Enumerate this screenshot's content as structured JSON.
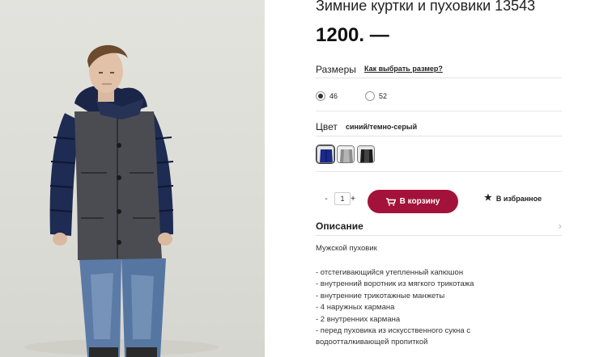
{
  "product": {
    "title": "Зимние куртки и пуховики 13543",
    "price": "1200. —",
    "photo_icon": "product-photo-man-in-winter-jacket"
  },
  "sizes": {
    "label": "Размеры",
    "guide_link": "Как выбрать размер?",
    "options": [
      {
        "label": "46",
        "selected": true
      },
      {
        "label": "52",
        "selected": false
      }
    ]
  },
  "color": {
    "label": "Цвет",
    "value": "синий/темно-серый",
    "swatches": [
      {
        "name": "blue",
        "hex": "#1a2a8a",
        "selected": true
      },
      {
        "name": "grey",
        "hex": "#b5b5b5",
        "selected": false
      },
      {
        "name": "black",
        "hex": "#1c1c1c",
        "selected": false
      }
    ]
  },
  "quantity": {
    "minus": "-",
    "value": "1",
    "plus": "+"
  },
  "actions": {
    "add_to_cart": "В корзину",
    "cart_icon": "cart-icon",
    "favorite": "В избранное",
    "favorite_icon": "star-icon",
    "accent_color": "#a3123a"
  },
  "description": {
    "title": "Описание",
    "chevron": "›",
    "intro": "Мужской пуховик",
    "items": [
      "- отстегивающийся утепленный капюшон",
      "- внутренний воротник из мягкого трикотажа",
      "- внутренние трикотажные манжеты",
      "- 4 наружных кармана",
      "- 2 внутренних кармана",
      "- перед пуховика из искусственного сукна с",
      "водоотталкивающей пропиткой"
    ]
  }
}
